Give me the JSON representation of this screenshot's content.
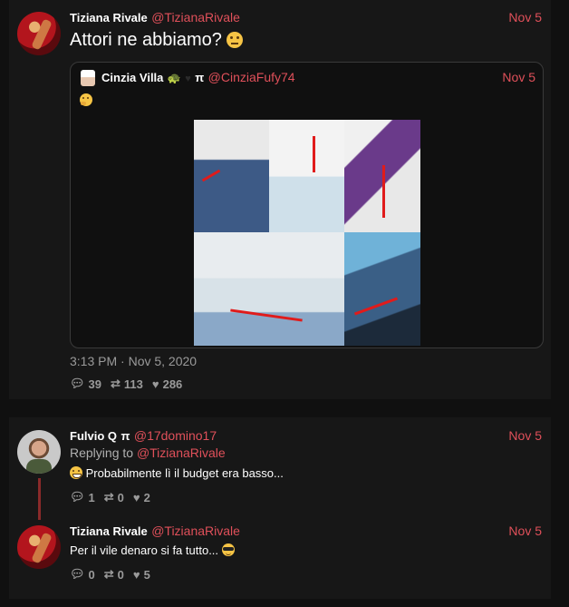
{
  "main_tweet": {
    "author_name": "Tiziana Rivale",
    "author_handle": "@TizianaRivale",
    "date": "Nov 5",
    "text": "Attori ne abbiamo?",
    "timestamp": "3:13 PM · Nov 5, 2020",
    "stats": {
      "replies": "39",
      "retweets": "113",
      "likes": "286"
    }
  },
  "quoted_tweet": {
    "author_name": "Cinzia Villa",
    "author_suffix": "π",
    "author_handle": "@CinziaFufy74",
    "date": "Nov 5"
  },
  "reply_1": {
    "author_name": "Fulvio Q",
    "author_suffix": "π",
    "author_handle": "@17domino17",
    "date": "Nov 5",
    "replying_label": "Replying to",
    "replying_handle": "@TizianaRivale",
    "text": "Probabilmente lì il budget era basso...",
    "stats": {
      "replies": "1",
      "retweets": "0",
      "likes": "2"
    }
  },
  "reply_2": {
    "author_name": "Tiziana Rivale",
    "author_handle": "@TizianaRivale",
    "date": "Nov 5",
    "text": "Per il vile denaro si fa tutto...",
    "stats": {
      "replies": "0",
      "retweets": "0",
      "likes": "5"
    }
  },
  "icons": {
    "reply": "comment-icon",
    "retweet": "retweet-icon",
    "like": "heart-icon"
  },
  "colors": {
    "accent": "#e0505a",
    "background": "#101010",
    "card": "#171717"
  }
}
